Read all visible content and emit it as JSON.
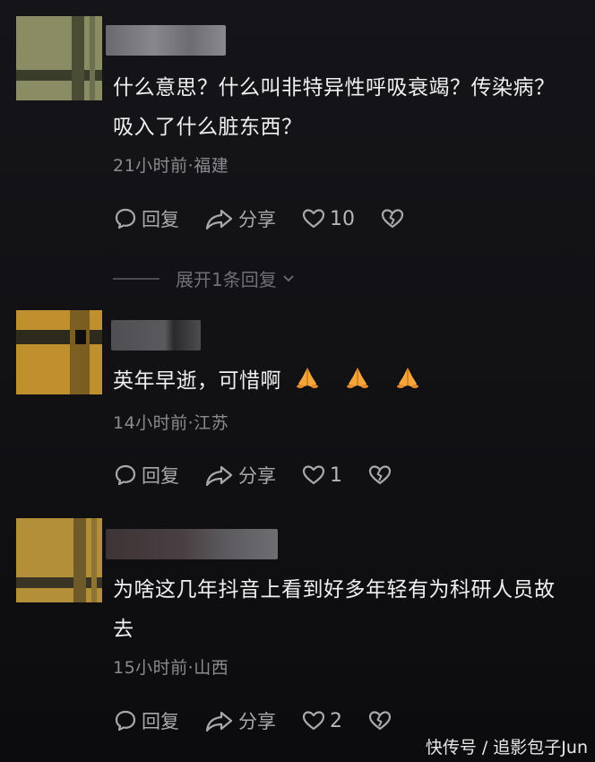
{
  "comments": [
    {
      "text": "什么意思？什么叫非特异性呼吸衰竭？传染病？吸入了什么脏东西？",
      "meta": "21小时前·福建",
      "reply_label": "回复",
      "share_label": "分享",
      "like_count": "10",
      "expand_label": "展开1条回复"
    },
    {
      "text": "英年早逝，可惜啊",
      "emoji": [
        "folded-hands",
        "folded-hands",
        "folded-hands"
      ],
      "meta": "14小时前·江苏",
      "reply_label": "回复",
      "share_label": "分享",
      "like_count": "1"
    },
    {
      "text": "为啥这几年抖音上看到好多年轻有为科研人员故去",
      "meta": "15小时前·山西",
      "reply_label": "回复",
      "share_label": "分享",
      "like_count": "2"
    }
  ],
  "watermark": "快传号 / 追影包子Jun",
  "colors": {
    "background": "#121215",
    "text": "#f0f0f0",
    "meta": "#8b8b90",
    "action": "#a9a9ad",
    "avatar1": "#8a8d63",
    "avatar2": "#c0902f",
    "avatar3": "#b48f3a"
  }
}
